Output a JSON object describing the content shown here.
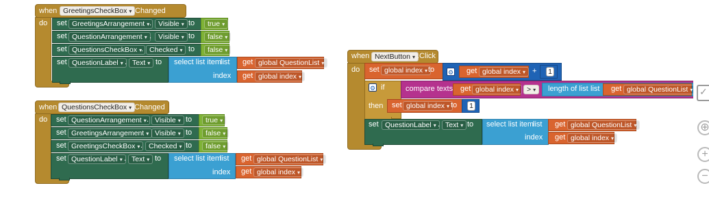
{
  "labels": {
    "when": "when",
    "do": "do",
    "set": "set",
    "to": "to",
    "dot": ".",
    "get": "get",
    "index": "index",
    "select_list_item": "select list item",
    "list": "list",
    "if": "if",
    "then": "then",
    "compare_texts": "compare texts",
    "length_of_list": "length of list",
    "plus": "+",
    "gt": ">"
  },
  "block1": {
    "component": "GreetingsCheckBox",
    "event": ".Changed",
    "rows": [
      {
        "component": "GreetingsArrangement",
        "property": "Visible",
        "value": "true"
      },
      {
        "component": "QuestionArrangement",
        "property": "Visible",
        "value": "false"
      },
      {
        "component": "QuestionsCheckBox",
        "property": "Checked",
        "value": "false"
      },
      {
        "component": "QuestionLabel",
        "property": "Text"
      }
    ],
    "list_var": "global QuestionList",
    "index_var": "global index"
  },
  "block2": {
    "component": "QuestionsCheckBox",
    "event": ".Changed",
    "rows": [
      {
        "component": "QuestionArrangement",
        "property": "Visible",
        "value": "true"
      },
      {
        "component": "GreetingsArrangement",
        "property": "Visible",
        "value": "false"
      },
      {
        "component": "GreetingsCheckBox",
        "property": "Checked",
        "value": "false"
      },
      {
        "component": "QuestionLabel",
        "property": "Text"
      }
    ],
    "list_var": "global QuestionList",
    "index_var": "global index"
  },
  "block3": {
    "component": "NextButton",
    "event": ".Click",
    "set_var": "global index",
    "get_var": "global index",
    "increment": "1",
    "compare_var": "global index",
    "compare_op": ">",
    "length_list_var": "global QuestionList",
    "reset_var": "global index",
    "reset_value": "1",
    "label_component": "QuestionLabel",
    "label_property": "Text",
    "list_var": "global QuestionList",
    "index_var": "global index"
  },
  "colors": {
    "event": "#b58a2f",
    "setter": "#2f6b4f",
    "list": "#3ba0d2",
    "variable": "#d9642f",
    "logic": "#7fb336",
    "math": "#1f63b5",
    "text": "#b5328e",
    "control": "#c79a3a"
  }
}
